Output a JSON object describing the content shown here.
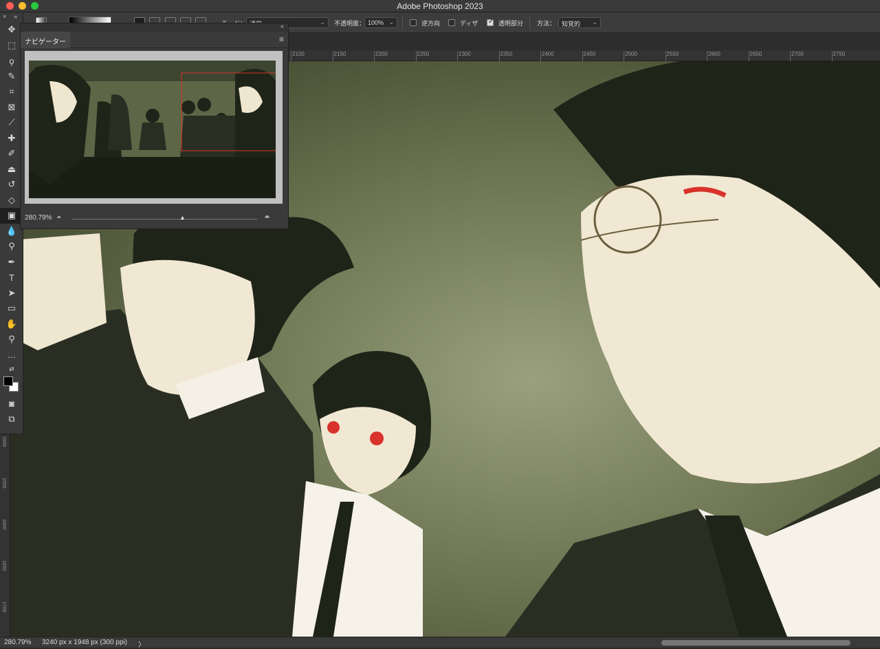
{
  "window": {
    "title": "Adobe Photoshop 2023"
  },
  "options": {
    "mode_label": "モード：",
    "mode_value": "通常",
    "opacity_label": "不透明度：",
    "opacity_value": "100%",
    "reverse_label": "逆方向",
    "dither_label": "ディザ",
    "transparency_label": "透明部分",
    "method_label": "方法：",
    "method_value": "知覚的",
    "reverse_checked": false,
    "dither_checked": false,
    "transparency_checked": true
  },
  "navigator": {
    "tab_label": "ナビゲーター",
    "zoom_value": "280.79%"
  },
  "ruler": {
    "top_ticks": [
      "2100",
      "2150",
      "2200",
      "2250",
      "2300",
      "2350",
      "2400",
      "2450",
      "2500",
      "2550",
      "2600",
      "2650",
      "2700",
      "2750"
    ],
    "left_ticks": [
      "1500",
      "1550",
      "1600",
      "1650",
      "1700"
    ]
  },
  "status": {
    "zoom": "280.79%",
    "doc_info": "3240 px x 1948 px (300 ppi)",
    "arrow": "〉"
  },
  "colors": {
    "canvas_bg": "#4a5236",
    "suit": "#2a2e22",
    "skin": "#f1e8d3",
    "hair": "#1f2418",
    "eye_red": "#d8322a"
  }
}
